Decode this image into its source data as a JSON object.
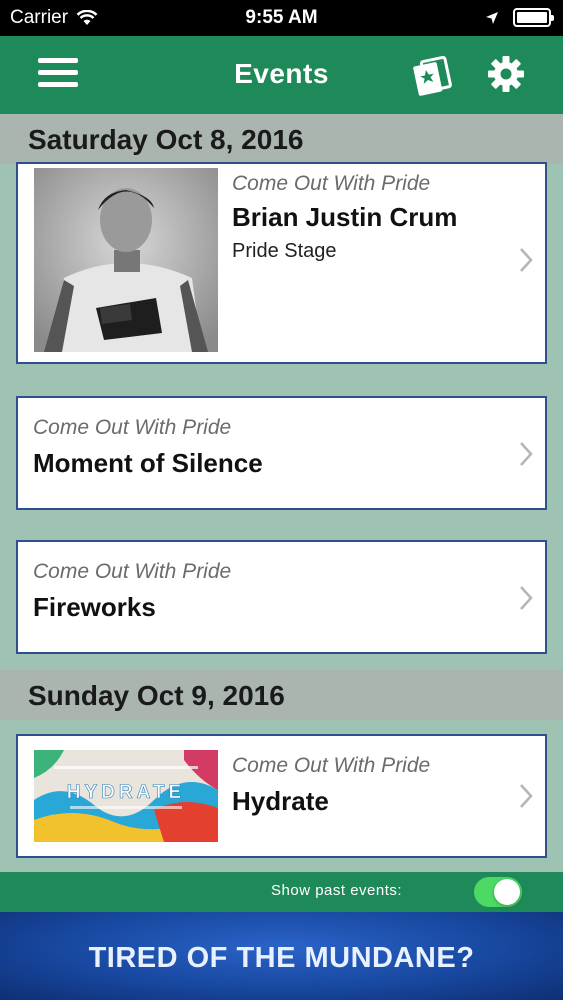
{
  "status_bar": {
    "carrier": "Carrier",
    "time": "9:55 AM",
    "battery_level": 1.0
  },
  "nav": {
    "title": "Events",
    "icons": [
      "menu-icon",
      "ticket-icon",
      "gear-icon"
    ]
  },
  "sections": [
    {
      "date": "Saturday Oct 8, 2016",
      "events": [
        {
          "category": "Come Out With Pride",
          "name": "Brian Justin Crum",
          "stage": "Pride Stage",
          "has_image": true
        },
        {
          "category": "Come Out With Pride",
          "name": "Moment of Silence"
        },
        {
          "category": "Come Out With Pride",
          "name": "Fireworks"
        }
      ]
    },
    {
      "date": "Sunday Oct 9, 2016",
      "events": [
        {
          "category": "Come Out With Pride",
          "name": "Hydrate",
          "has_image": true,
          "image_text": "HYDRATE"
        }
      ]
    }
  ],
  "footer": {
    "past_events_label": "Show past events:",
    "past_events_on": true
  },
  "banner": {
    "text": "TIRED OF THE MUNDANE?"
  },
  "colors": {
    "nav_green": "#1f8a59",
    "background": "#9ec3b3",
    "card_border": "#2f4f8f",
    "toggle_on": "#4cd964"
  }
}
